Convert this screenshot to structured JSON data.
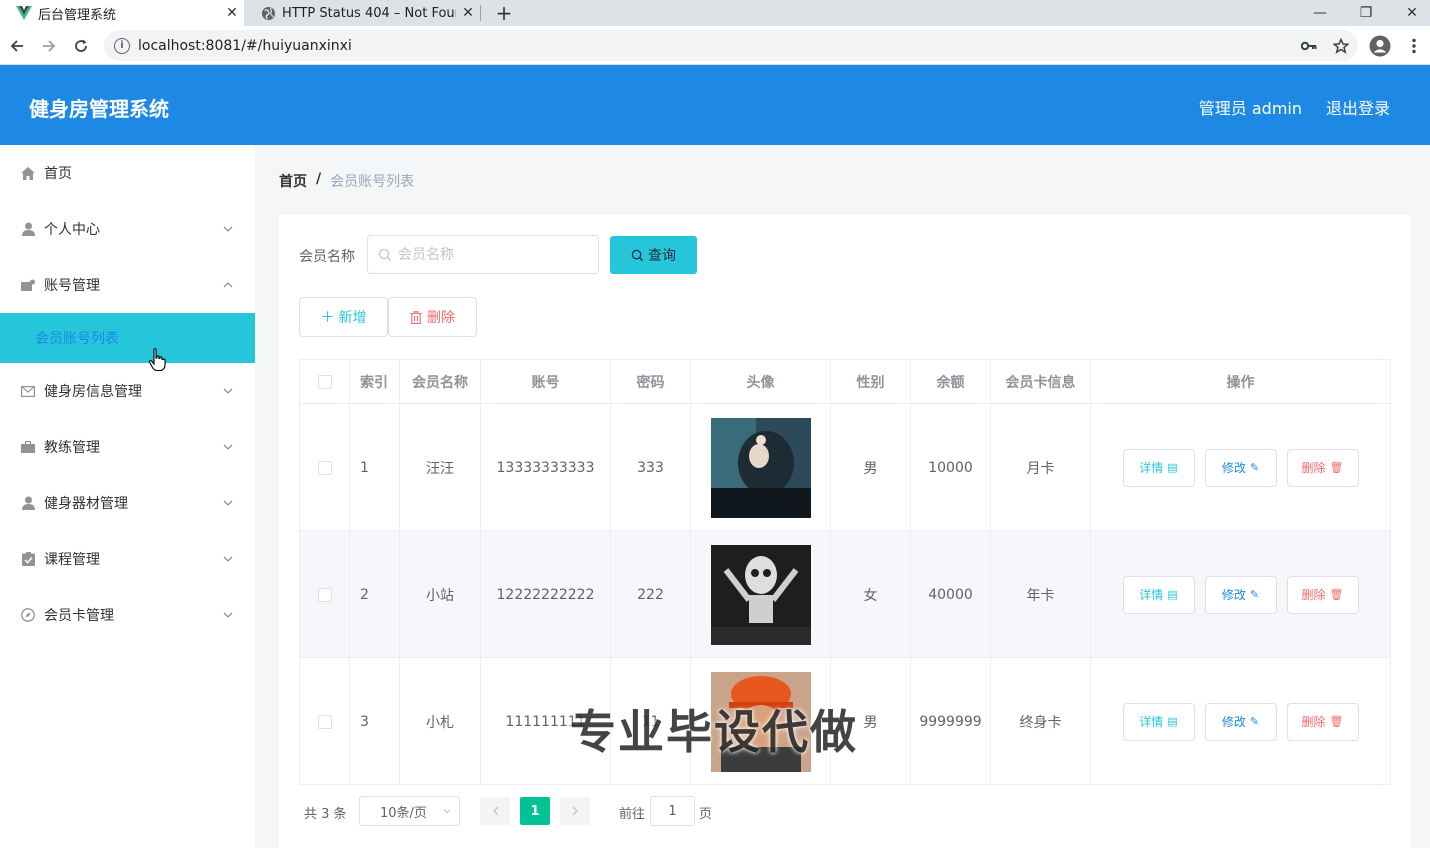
{
  "browser": {
    "tabs": [
      {
        "title": "后台管理系统",
        "active": true
      },
      {
        "title": "HTTP Status 404 – Not Found",
        "active": false
      }
    ],
    "url": "localhost:8081/#/huiyuanxinxi"
  },
  "header": {
    "title": "健身房管理系统",
    "user": "管理员 admin",
    "logout": "退出登录"
  },
  "sidebar": {
    "items": [
      {
        "label": "首页",
        "icon": "home-icon"
      },
      {
        "label": "个人中心",
        "icon": "user-icon"
      },
      {
        "label": "账号管理",
        "icon": "account-icon",
        "expanded": true
      },
      {
        "label": "健身房信息管理",
        "icon": "mail-icon"
      },
      {
        "label": "教练管理",
        "icon": "briefcase-icon"
      },
      {
        "label": "健身器材管理",
        "icon": "user-icon"
      },
      {
        "label": "课程管理",
        "icon": "checklist-icon"
      },
      {
        "label": "会员卡管理",
        "icon": "compass-icon"
      }
    ],
    "active_sub": "会员账号列表"
  },
  "breadcrumb": {
    "home": "首页",
    "sep": "/",
    "current": "会员账号列表"
  },
  "search": {
    "label": "会员名称",
    "placeholder": "会员名称",
    "button": "查询"
  },
  "actions": {
    "add": "新增",
    "delete": "删除"
  },
  "table": {
    "columns": [
      "索引",
      "会员名称",
      "账号",
      "密码",
      "头像",
      "性别",
      "余额",
      "会员卡信息",
      "操作"
    ],
    "rows": [
      {
        "index": "1",
        "name": "汪汪",
        "account": "13333333333",
        "password": "333",
        "gender": "男",
        "balance": "10000",
        "card": "月卡"
      },
      {
        "index": "2",
        "name": "小站",
        "account": "12222222222",
        "password": "222",
        "gender": "女",
        "balance": "40000",
        "card": "年卡"
      },
      {
        "index": "3",
        "name": "小札",
        "account": "111111111",
        "password": "11",
        "gender": "男",
        "balance": "9999999",
        "card": "终身卡"
      }
    ],
    "ops": {
      "detail": "详情",
      "edit": "修改",
      "delete": "删除"
    }
  },
  "pagination": {
    "total": "共 3 条",
    "page_size": "10条/页",
    "current": "1",
    "goto": "前往",
    "goto_value": "1",
    "page": "页"
  },
  "watermark": "专业毕设代做",
  "colors": {
    "primary": "#1e88e5",
    "accent": "#26c6da",
    "danger": "#f56c6c",
    "pager_active": "#00c292"
  }
}
